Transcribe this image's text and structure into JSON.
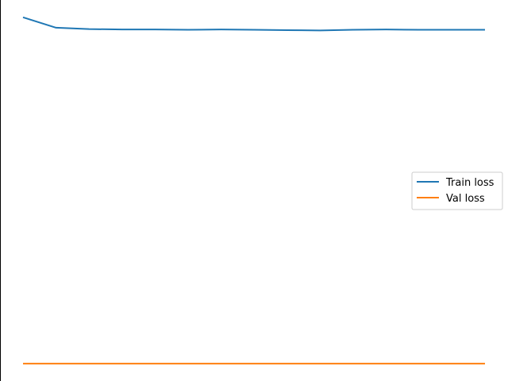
{
  "chart_data": {
    "type": "line",
    "x": [
      0,
      1,
      2,
      3,
      4,
      5,
      6,
      7,
      8,
      9,
      10,
      11,
      12,
      13,
      14
    ],
    "series": [
      {
        "name": "Train loss",
        "color": "#1f77b4",
        "values": [
          1.0,
          0.97,
          0.966,
          0.965,
          0.965,
          0.964,
          0.965,
          0.964,
          0.963,
          0.962,
          0.964,
          0.965,
          0.964,
          0.964,
          0.964
        ]
      },
      {
        "name": "Val loss",
        "color": "#ff7f0e",
        "values": [
          0.0,
          0.0,
          0.0,
          0.0,
          0.0,
          0.0,
          0.0,
          0.0,
          0.0,
          0.0,
          0.0,
          0.0,
          0.0,
          0.0,
          0.0
        ]
      }
    ],
    "ylim": [
      -0.05,
      1.05
    ],
    "grid": false,
    "axes_visible": false,
    "legend_location": "center-right"
  }
}
